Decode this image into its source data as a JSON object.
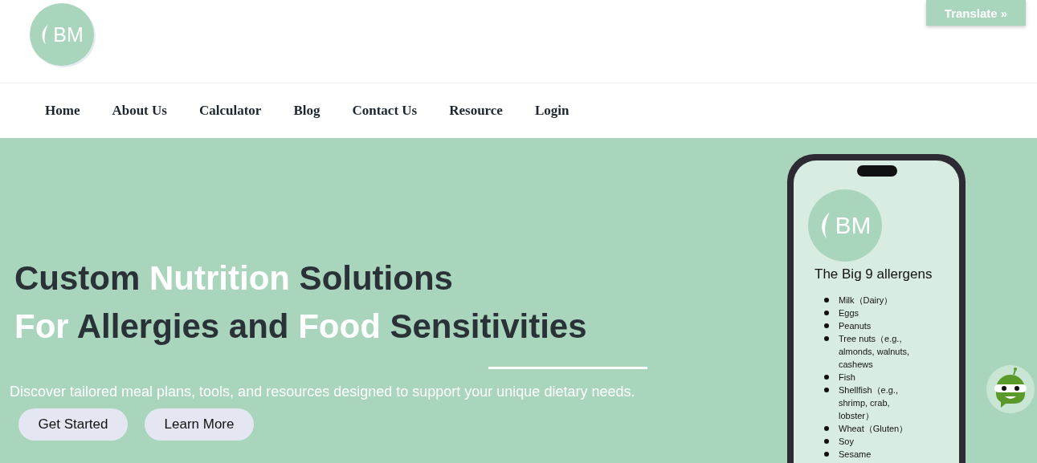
{
  "logo": {
    "text": "BM"
  },
  "translate_button": {
    "label": "Translate »"
  },
  "nav": {
    "items": [
      {
        "label": "Home"
      },
      {
        "label": "About Us"
      },
      {
        "label": "Calculator"
      },
      {
        "label": "Blog"
      },
      {
        "label": "Contact Us"
      },
      {
        "label": "Resource"
      },
      {
        "label": "Login"
      }
    ]
  },
  "hero": {
    "heading": [
      [
        {
          "text": "Custom ",
          "highlight": false
        },
        {
          "text": "Nutrition",
          "highlight": true
        },
        {
          "text": " Solutions",
          "highlight": false
        }
      ],
      [
        {
          "text": "For",
          "highlight": true
        },
        {
          "text": " Allergies and ",
          "highlight": false
        },
        {
          "text": "Food",
          "highlight": true
        },
        {
          "text": " Sensitivities",
          "highlight": false
        }
      ]
    ],
    "subtitle": "Discover tailored meal plans, tools, and resources designed to support your unique dietary needs.",
    "buttons": [
      {
        "label": "Get Started"
      },
      {
        "label": "Learn More"
      }
    ]
  },
  "phone": {
    "logo_text": "BM",
    "title": "The Big 9 allergens",
    "items": [
      "Milk（Dairy）",
      "Eggs",
      "Peanuts",
      "Tree nuts（e.g., almonds, walnuts, cashews",
      "Fish",
      "Shellfish（e.g., shrimp, crab, lobster）",
      "Wheat（Gluten）",
      "Soy",
      "Sesame"
    ]
  }
}
